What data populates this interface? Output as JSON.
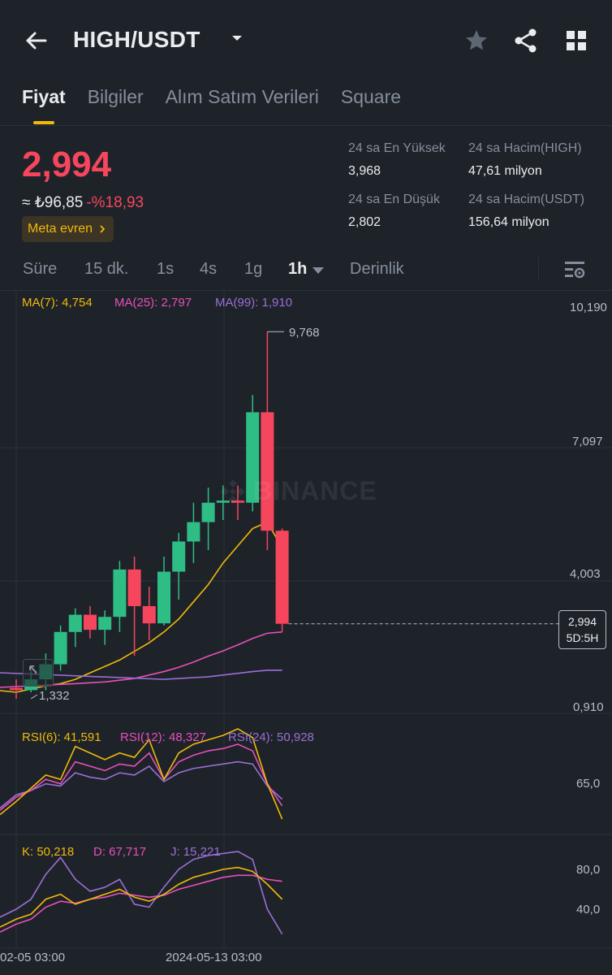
{
  "header": {
    "pair": "HIGH/USDT",
    "icons": [
      "back-arrow-icon",
      "caret-down-icon",
      "star-icon",
      "share-icon",
      "grid-icon"
    ]
  },
  "tabs": [
    "Fiyat",
    "Bilgiler",
    "Alım Satım Verileri",
    "Square"
  ],
  "price": {
    "last": "2,994",
    "fiat": "≈ ₺96,85",
    "change": "-%18,93",
    "tag": "Meta evren"
  },
  "stats": {
    "high_label": "24 sa En Yüksek",
    "high": "3,968",
    "low_label": "24 sa En Düşük",
    "low": "2,802",
    "vol_base_label": "24 sa Hacim(HIGH)",
    "vol_base": "47,61 milyon",
    "vol_quote_label": "24 sa Hacim(USDT)",
    "vol_quote": "156,64 milyon"
  },
  "intervals": [
    "Süre",
    "15 dk.",
    "1s",
    "4s",
    "1g",
    "1h",
    "Derinlik"
  ],
  "colors": {
    "up": "#2ebd85",
    "down": "#f6465d",
    "accent": "#f0b90b",
    "ma7": "#f0b90b",
    "ma25": "#e84fbd",
    "ma99": "#9b6fd8"
  },
  "chart": {
    "ma7": "MA(7): 4,754",
    "ma25": "MA(25): 2,797",
    "ma99": "MA(99): 1,910",
    "axis_labels": [
      "10,190",
      "7,097",
      "4,003",
      "0,910"
    ],
    "high_marker": "9,768",
    "low_marker": "1,332",
    "last_price": "2,994",
    "countdown": "5D:5H",
    "watermark": "BINANCE",
    "rsi6": "RSI(6): 41,591",
    "rsi12": "RSI(12): 48,327",
    "rsi24": "RSI(24): 50,928",
    "rsi_axis": "65,0",
    "k": "K: 50,218",
    "d": "D: 67,717",
    "j": "J: 15,221",
    "kdj_axis": [
      "80,0",
      "40,0"
    ],
    "times": [
      "02-05 03:00",
      "2024-05-13 03:00"
    ]
  },
  "chart_data": {
    "type": "candlestick",
    "interval": "1h",
    "candles_ohlc": [
      [
        1.5,
        1.7,
        1.25,
        1.45
      ],
      [
        1.45,
        1.9,
        1.4,
        1.7
      ],
      [
        1.7,
        2.3,
        1.45,
        2.05
      ],
      [
        2.05,
        2.95,
        1.9,
        2.8
      ],
      [
        2.8,
        3.35,
        2.45,
        3.2
      ],
      [
        3.2,
        3.4,
        2.65,
        2.85
      ],
      [
        2.85,
        3.3,
        2.5,
        3.15
      ],
      [
        3.15,
        4.45,
        2.8,
        4.25
      ],
      [
        4.25,
        4.55,
        2.25,
        3.4
      ],
      [
        3.4,
        3.85,
        2.6,
        3.0
      ],
      [
        3.0,
        4.55,
        2.95,
        4.2
      ],
      [
        4.2,
        5.1,
        3.55,
        4.9
      ],
      [
        4.9,
        5.8,
        4.4,
        5.35
      ],
      [
        5.35,
        6.15,
        4.7,
        5.8
      ],
      [
        5.8,
        6.2,
        5.4,
        5.85
      ],
      [
        5.85,
        6.2,
        5.4,
        5.8
      ],
      [
        5.8,
        8.3,
        5.6,
        7.9
      ],
      [
        7.9,
        9.77,
        4.7,
        5.15
      ],
      [
        5.15,
        5.2,
        2.8,
        2.99
      ]
    ],
    "ma7": [
      1.55,
      1.6,
      1.7,
      1.85,
      2.0,
      2.15,
      2.35,
      2.55,
      2.8,
      3.1,
      3.5,
      3.9,
      4.4,
      4.8,
      5.2,
      5.35,
      4.75
    ],
    "ma25": [
      1.6,
      1.62,
      1.64,
      1.68,
      1.72,
      1.8,
      1.88,
      1.98,
      2.1,
      2.24,
      2.36,
      2.5,
      2.65,
      2.77,
      2.8
    ],
    "ma99": [
      1.7,
      1.72,
      1.74,
      1.76,
      1.8,
      1.84,
      1.88,
      1.91,
      1.91
    ],
    "rsi6": [
      50,
      56,
      62,
      60,
      75,
      72,
      69,
      72,
      70,
      78,
      60,
      72,
      76,
      78,
      80,
      83,
      79,
      58,
      42
    ],
    "rsi12": [
      52,
      55,
      60,
      58,
      68,
      66,
      64,
      67,
      66,
      72,
      60,
      68,
      71,
      73,
      74,
      76,
      73,
      58,
      48
    ],
    "rsi24": [
      53,
      55,
      58,
      57,
      63,
      61,
      60,
      63,
      62,
      66,
      59,
      63,
      65,
      66,
      67,
      68,
      67,
      57,
      51
    ],
    "k": [
      30,
      35,
      50,
      55,
      45,
      50,
      55,
      60,
      52,
      48,
      55,
      65,
      72,
      76,
      80,
      82,
      78,
      65,
      50
    ],
    "d": [
      25,
      30,
      42,
      48,
      46,
      50,
      52,
      56,
      54,
      52,
      54,
      60,
      64,
      68,
      72,
      74,
      74,
      70,
      68
    ],
    "j": [
      40,
      50,
      75,
      92,
      70,
      58,
      62,
      70,
      45,
      42,
      62,
      80,
      90,
      94,
      96,
      98,
      90,
      40,
      15
    ],
    "price_axis": [
      0.91,
      4.003,
      7.097,
      10.19
    ]
  }
}
